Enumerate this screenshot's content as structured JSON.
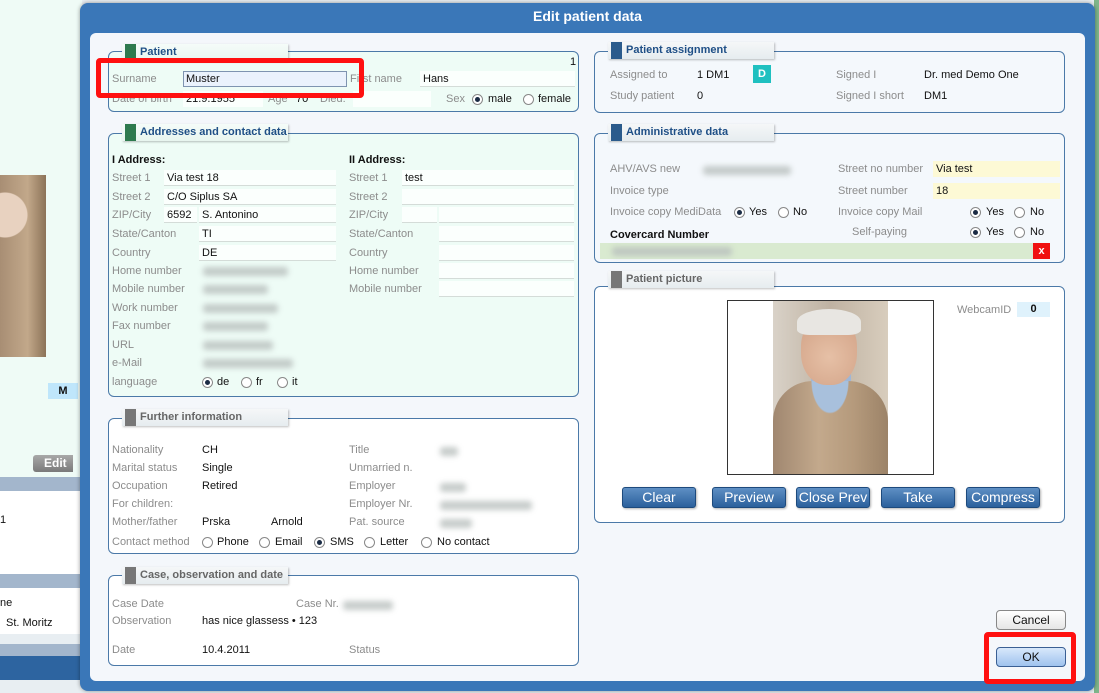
{
  "background": {
    "badge": "M",
    "edit_tab": "Edit",
    "row_text_1": "1",
    "row_text_2": "ne",
    "row_text_3": "St. Moritz"
  },
  "dialog": {
    "title": "Edit patient data",
    "cancel_label": "Cancel",
    "ok_label": "OK"
  },
  "patient": {
    "header": "Patient",
    "record_number": "1",
    "surname_label": "Surname",
    "surname": "Muster",
    "firstname_label": "First name",
    "firstname": "Hans",
    "dob_label": "Date of birth",
    "dob": "21.9.1955",
    "age_label": "Age",
    "age": "70",
    "died_label": "Died:",
    "sex_label": "Sex",
    "sex_options": [
      "male",
      "female"
    ],
    "sex_selected": "male"
  },
  "addresses": {
    "header": "Addresses and contact data",
    "addr1_title": "I Address:",
    "addr2_title": "II Address:",
    "labels": [
      "Street 1",
      "Street 2",
      "ZIP/City",
      "State/Canton",
      "Country",
      "Home number",
      "Mobile number",
      "Work number",
      "Fax number",
      "URL",
      "e-Mail"
    ],
    "addr1": {
      "street1": "Via test 18",
      "street2": "C/O Siplus SA",
      "zip": "6592",
      "city": "S. Antonino",
      "state": "TI",
      "country": "DE"
    },
    "addr2_labels": [
      "Street 1",
      "Street 2",
      "ZIP/City",
      "State/Canton",
      "Country",
      "Home number",
      "Mobile number"
    ],
    "addr2": {
      "street1": "test"
    },
    "language_label": "language",
    "language_options": [
      "de",
      "fr",
      "it"
    ],
    "language_selected": "de"
  },
  "further": {
    "header": "Further information",
    "nationality_label": "Nationality",
    "nationality": "CH",
    "marital_label": "Marital status",
    "marital": "Single",
    "occupation_label": "Occupation",
    "occupation": "Retired",
    "children_label": "For children:",
    "parents_label": "Mother/father",
    "mother": "Prska",
    "father": "Arnold",
    "title_label": "Title",
    "unmarried_label": "Unmarried n.",
    "employer_label": "Employer",
    "employer_nr_label": "Employer Nr.",
    "source_label": "Pat. source",
    "contact_label": "Contact method",
    "contact_options": [
      "Phone",
      "Email",
      "SMS",
      "Letter",
      "No contact"
    ],
    "contact_selected": "SMS"
  },
  "case": {
    "header": "Case, observation and date",
    "case_date_label": "Case Date",
    "case_nr_label": "Case Nr.",
    "observation_label": "Observation",
    "observation": "has nice glassess • 123",
    "date_label": "Date",
    "date": "10.4.2011",
    "status_label": "Status"
  },
  "assignment": {
    "header": "Patient assignment",
    "assigned_label": "Assigned to",
    "assigned": "1 DM1",
    "badge": "D",
    "study_label": "Study patient",
    "study": "0",
    "signed_label": "Signed I",
    "signed": "Dr. med Demo One",
    "signed_short_label": "Signed I short",
    "signed_short": "DM1"
  },
  "admin": {
    "header": "Administrative data",
    "ahv_label": "AHV/AVS new",
    "invoice_type_label": "Invoice type",
    "medidata_label": "Invoice copy MediData",
    "yes": "Yes",
    "no": "No",
    "covercard_label": "Covercard Number",
    "street_no_number_label": "Street no number",
    "street_no_number": "Via test",
    "street_number_label": "Street number",
    "street_number": "18",
    "mail_label": "Invoice copy Mail",
    "selfpay_label": "Self-paying",
    "clear_x": "x"
  },
  "picture": {
    "header": "Patient picture",
    "webcam_label": "WebcamID",
    "webcam_id": "0",
    "buttons": [
      "Clear",
      "Preview",
      "Close Prev",
      "Take",
      "Compress"
    ]
  },
  "colors": {
    "title_bar": "#1f5f9e",
    "accent_badge": "#1fc0c0",
    "highlight": "#ff1010",
    "yellow_field": "#fdf9d5"
  }
}
